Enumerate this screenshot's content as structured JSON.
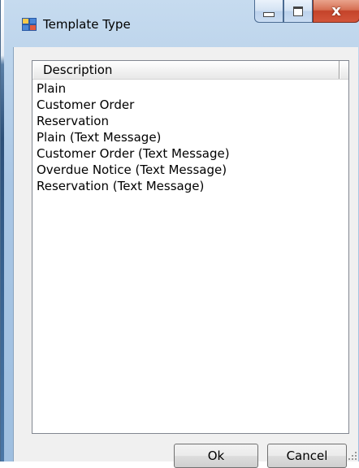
{
  "window": {
    "title": "Template Type",
    "controls": {
      "minimize": "minimize",
      "maximize": "maximize",
      "close": "x"
    }
  },
  "list": {
    "column_header": "Description",
    "items": [
      "Plain",
      "Customer Order",
      "Reservation",
      "Plain (Text Message)",
      "Customer Order (Text Message)",
      "Overdue Notice (Text Message)",
      "Reservation (Text Message)"
    ]
  },
  "buttons": {
    "ok": "Ok",
    "cancel": "Cancel"
  },
  "colors": {
    "frame": "#a9c6e4",
    "client": "#f0f0f0",
    "close_button": "#c4432a"
  },
  "icons": [
    "window-app-icon",
    "minimize-icon",
    "maximize-icon",
    "close-icon",
    "resize-grip-icon"
  ]
}
